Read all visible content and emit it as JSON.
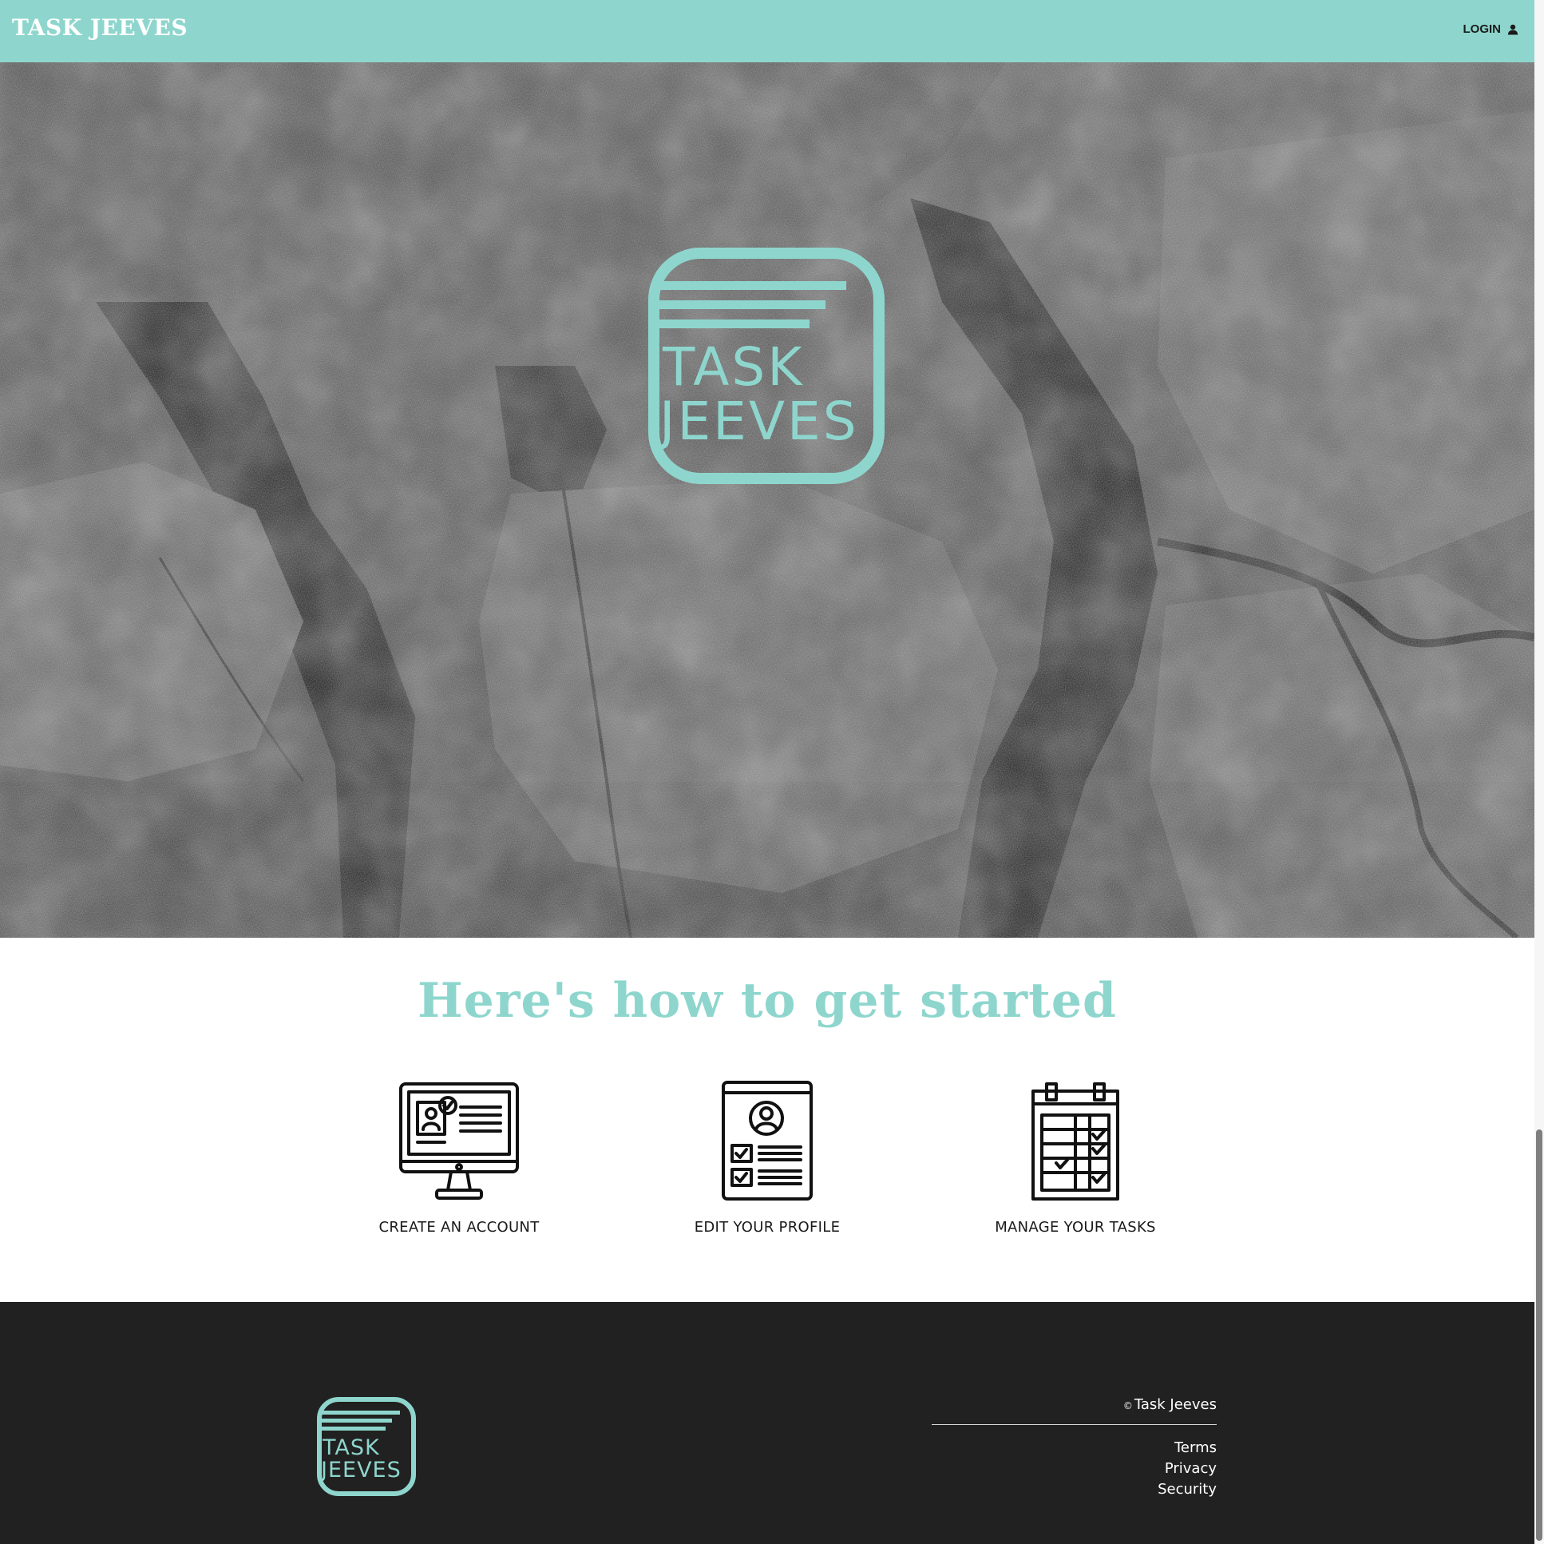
{
  "header": {
    "brand": "TASK JEEVES",
    "login_label": "LOGIN",
    "background_color": "#8ed6cd"
  },
  "hero": {
    "logo": {
      "line1": "TASK",
      "line2": "JEEVES",
      "color": "#8ed6cd"
    }
  },
  "howto": {
    "title": "Here's how to get started",
    "steps": [
      {
        "label": "CREATE AN ACCOUNT",
        "icon": "computer-monitor-profile-icon"
      },
      {
        "label": "EDIT YOUR PROFILE",
        "icon": "profile-document-checklist-icon"
      },
      {
        "label": "MANAGE YOUR TASKS",
        "icon": "calendar-checklist-icon"
      }
    ]
  },
  "footer": {
    "logo": {
      "line1": "TASK",
      "line2": "JEEVES"
    },
    "copyright_symbol": "©",
    "copyright_text": "Task Jeeves",
    "links": [
      "Terms",
      "Privacy",
      "Security"
    ],
    "background_color": "#212121"
  }
}
